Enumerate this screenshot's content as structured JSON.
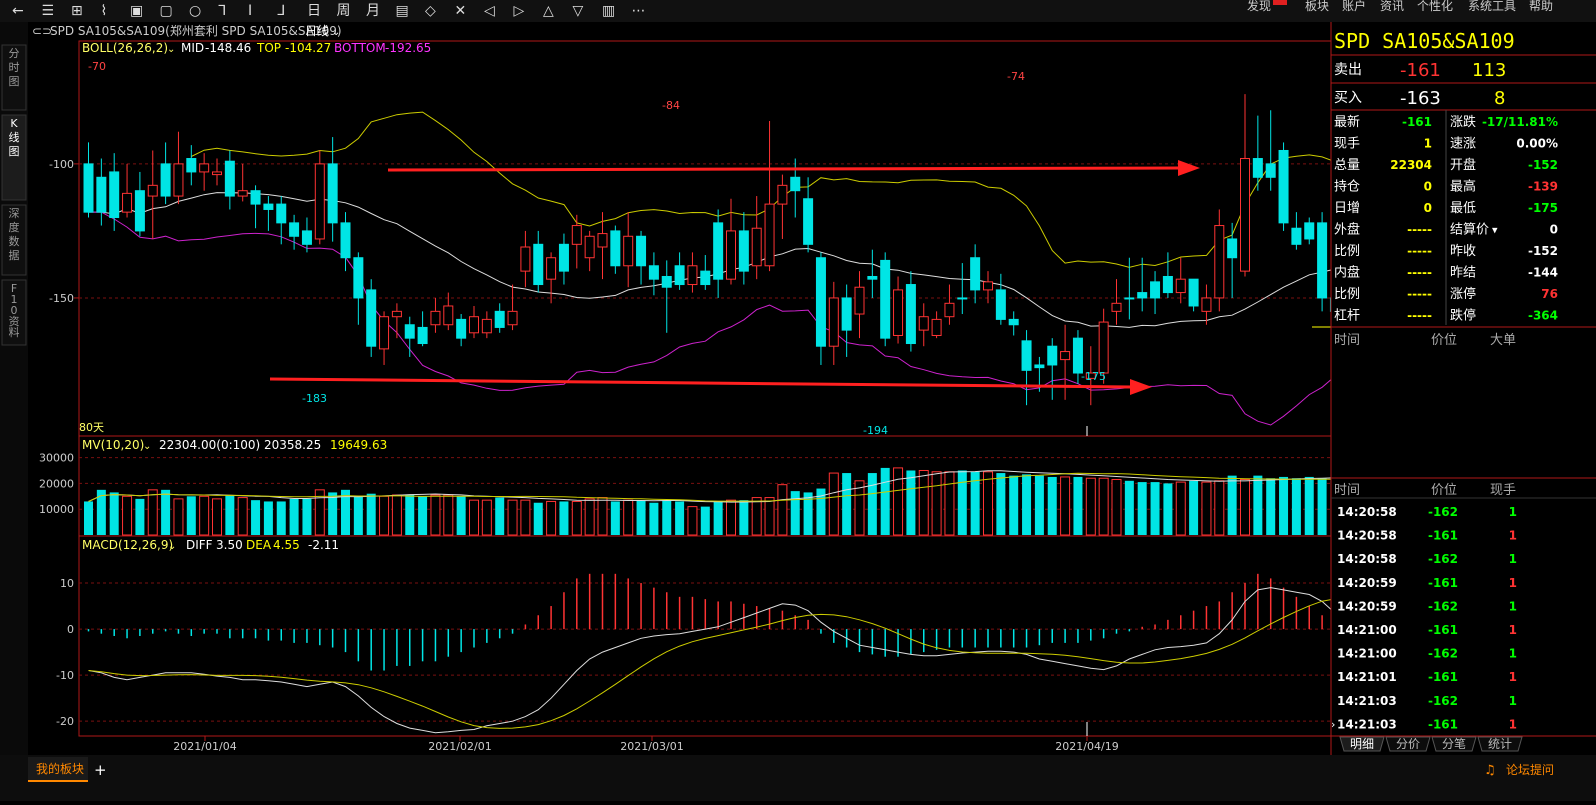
{
  "toolbar": {
    "left_icons": [
      "back-icon",
      "list-icon",
      "layout-icon",
      "line-tool-icon",
      "page-icon",
      "folder-icon",
      "circle-icon",
      "step-icon",
      "step2-icon",
      "step3-icon",
      "day-icon",
      "week-icon",
      "month-icon",
      "note-icon",
      "expand-icon",
      "collapse-icon",
      "prev-icon",
      "next-icon",
      "up-icon",
      "down-icon",
      "grid-icon",
      "more-icon"
    ],
    "glyphs": [
      "←",
      "☰",
      "⊞",
      "⌇",
      "▣",
      "▢",
      "○",
      "⅂",
      "Ⅰ",
      "⅃",
      "日",
      "周",
      "月",
      "▤",
      "◇",
      "✕",
      "◁",
      "▷",
      "△",
      "▽",
      "▥",
      "⋯"
    ],
    "menu": [
      "发现",
      "板块",
      "账户",
      "资讯",
      "个性化",
      "系统工具",
      "帮助"
    ]
  },
  "side_tabs": [
    "分时图",
    "K线图",
    "深度数据",
    "F10资料"
  ],
  "chart_header": {
    "title": "SPD SA105&SA109(郑州套利 SPD SA105&SA109)",
    "period": "日线"
  },
  "boll": {
    "name": "BOLL(26,26,2)",
    "mid_label": "MID",
    "mid": "-148.46",
    "top_label": "TOP",
    "top": "-104.27",
    "bottom_label": "BOTTOM",
    "bottom": "-192.65"
  },
  "volume_header": {
    "name": "MV(10,20)",
    "v1": "22304.00(0:100)",
    "v2": "20358.25",
    "v3": "19649.63"
  },
  "macd_header": {
    "name": "MACD(12,26,9)",
    "diff_label": "DIFF",
    "diff": "3.50",
    "dea_label": "DEA",
    "dea": "4.55",
    "macd": "-2.11"
  },
  "days_label": "80天",
  "price_axis": [
    "-100",
    "-150"
  ],
  "volume_axis": [
    "30000",
    "20000",
    "10000"
  ],
  "macd_axis": [
    "10",
    "0",
    "-10",
    "-20"
  ],
  "date_axis": [
    "2021/01/04",
    "2021/02/01",
    "2021/03/01",
    "2021/04/19"
  ],
  "annotations": {
    "high1": "-70",
    "high2": "-84",
    "high3": "-74",
    "low1": "-183",
    "low2": "-194",
    "low3": "-175"
  },
  "chart_data": {
    "type": "candlestick",
    "price_ylim": [
      -200,
      -62
    ],
    "volume_ylim": [
      0,
      31000
    ],
    "macd_ylim": [
      -23,
      15
    ],
    "candles": [
      [
        -100,
        -118,
        -92,
        -120
      ],
      [
        -105,
        -118,
        -98,
        -123
      ],
      [
        -103,
        -120,
        -96,
        -125
      ],
      [
        -118,
        -111,
        -100,
        -120
      ],
      [
        -110,
        -125,
        -103,
        -127
      ],
      [
        -112,
        -108,
        -95,
        -128
      ],
      [
        -100,
        -112,
        -92,
        -115
      ],
      [
        -112,
        -100,
        -88,
        -115
      ],
      [
        -98,
        -103,
        -93,
        -108
      ],
      [
        -103,
        -100,
        -96,
        -110
      ],
      [
        -104,
        -103,
        -98,
        -108
      ],
      [
        -99,
        -112,
        -95,
        -117
      ],
      [
        -112,
        -110,
        -100,
        -114
      ],
      [
        -110,
        -115,
        -108,
        -124
      ],
      [
        -115,
        -117,
        -112,
        -125
      ],
      [
        -115,
        -122,
        -112,
        -130
      ],
      [
        -122,
        -127,
        -119,
        -132
      ],
      [
        -125,
        -130,
        -120,
        -133
      ],
      [
        -128,
        -100,
        -95,
        -130
      ],
      [
        -100,
        -122,
        -90,
        -129
      ],
      [
        -122,
        -135,
        -118,
        -140
      ],
      [
        -135,
        -150,
        -133,
        -160
      ],
      [
        -147,
        -168,
        -143,
        -172
      ],
      [
        -169,
        -157,
        -155,
        -175
      ],
      [
        -157,
        -155,
        -152,
        -165
      ],
      [
        -160,
        -165,
        -157,
        -172
      ],
      [
        -161,
        -167,
        -155,
        -168
      ],
      [
        -160,
        -155,
        -150,
        -163
      ],
      [
        -160,
        -153,
        -148,
        -162
      ],
      [
        -158,
        -165,
        -156,
        -168
      ],
      [
        -163,
        -157,
        -153,
        -165
      ],
      [
        -163,
        -158,
        -155,
        -165
      ],
      [
        -155,
        -161,
        -152,
        -163
      ],
      [
        -160,
        -155,
        -145,
        -162
      ],
      [
        -140,
        -131,
        -125,
        -146
      ],
      [
        -130,
        -145,
        -125,
        -148
      ],
      [
        -143,
        -135,
        -133,
        -152
      ],
      [
        -130,
        -140,
        -126,
        -145
      ],
      [
        -130,
        -123,
        -119,
        -139
      ],
      [
        -135,
        -127,
        -125,
        -140
      ],
      [
        -131,
        -126,
        -118,
        -143
      ],
      [
        -125,
        -138,
        -123,
        -141
      ],
      [
        -138,
        -127,
        -118,
        -146
      ],
      [
        -127,
        -138,
        -125,
        -145
      ],
      [
        -138,
        -143,
        -133,
        -149
      ],
      [
        -142,
        -146,
        -136,
        -163
      ],
      [
        -138,
        -145,
        -133,
        -147
      ],
      [
        -145,
        -138,
        -133,
        -148
      ],
      [
        -140,
        -145,
        -134,
        -147
      ],
      [
        -122,
        -143,
        -117,
        -150
      ],
      [
        -143,
        -125,
        -113,
        -145
      ],
      [
        -125,
        -140,
        -118,
        -145
      ],
      [
        -138,
        -124,
        -112,
        -143
      ],
      [
        -138,
        -115,
        -84,
        -140
      ],
      [
        -115,
        -108,
        -104,
        -128
      ],
      [
        -105,
        -110,
        -98,
        -120
      ],
      [
        -113,
        -130,
        -105,
        -133
      ],
      [
        -135,
        -168,
        -133,
        -175
      ],
      [
        -168,
        -150,
        -144,
        -175
      ],
      [
        -150,
        -162,
        -145,
        -172
      ],
      [
        -156,
        -146,
        -140,
        -165
      ],
      [
        -142,
        -143,
        -132,
        -150
      ],
      [
        -136,
        -165,
        -133,
        -168
      ],
      [
        -164,
        -147,
        -142,
        -167
      ],
      [
        -145,
        -167,
        -140,
        -170
      ],
      [
        -162,
        -157,
        -152,
        -168
      ],
      [
        -164,
        -158,
        -155,
        -165
      ],
      [
        -157,
        -152,
        -145,
        -160
      ],
      [
        -150,
        -150,
        -137,
        -156
      ],
      [
        -135,
        -147,
        -130,
        -152
      ],
      [
        -147,
        -144,
        -140,
        -152
      ],
      [
        -147,
        -158,
        -141,
        -160
      ],
      [
        -158,
        -160,
        -155,
        -164
      ],
      [
        -166,
        -177,
        -162,
        -190
      ],
      [
        -175,
        -176,
        -172,
        -185
      ],
      [
        -168,
        -175,
        -165,
        -188
      ],
      [
        -173,
        -170,
        -160,
        -188
      ],
      [
        -165,
        -178,
        -162,
        -182
      ],
      [
        -180,
        -178,
        -168,
        -190
      ],
      [
        -178,
        -159,
        -154,
        -182
      ],
      [
        -155,
        -152,
        -143,
        -160
      ],
      [
        -150,
        -150,
        -135,
        -158
      ],
      [
        -148,
        -150,
        -135,
        -155
      ],
      [
        -144,
        -150,
        -140,
        -156
      ],
      [
        -142,
        -148,
        -133,
        -150
      ],
      [
        -148,
        -143,
        -135,
        -152
      ],
      [
        -143,
        -153,
        -143,
        -155
      ],
      [
        -155,
        -150,
        -145,
        -160
      ],
      [
        -150,
        -123,
        -117,
        -155
      ],
      [
        -128,
        -135,
        -122,
        -150
      ],
      [
        -140,
        -98,
        -74,
        -142
      ],
      [
        -98,
        -105,
        -82,
        -110
      ],
      [
        -100,
        -105,
        -80,
        -110
      ],
      [
        -95,
        -122,
        -92,
        -125
      ],
      [
        -124,
        -130,
        -118,
        -132
      ],
      [
        -122,
        -128,
        -120,
        -130
      ],
      [
        -122,
        -150,
        -118,
        -155
      ],
      [
        -150,
        -155,
        -140,
        -162
      ],
      [
        -152,
        -161,
        -148,
        -175
      ]
    ],
    "volume": [
      13000,
      17500,
      16500,
      15000,
      14000,
      17500,
      17500,
      14000,
      15000,
      15000,
      14000,
      15500,
      14500,
      13500,
      13000,
      13000,
      14000,
      14000,
      17500,
      16500,
      17500,
      15000,
      16000,
      15000,
      15500,
      15500,
      15000,
      15500,
      15500,
      15000,
      13500,
      13500,
      14500,
      13500,
      13500,
      12500,
      13000,
      13000,
      13000,
      14000,
      14500,
      13000,
      13500,
      13500,
      12500,
      13500,
      13000,
      11000,
      11000,
      13000,
      13500,
      13500,
      14500,
      14500,
      19500,
      17000,
      16500,
      18000,
      24000,
      24000,
      21000,
      24000,
      26000,
      26000,
      25000,
      25000,
      24500,
      24500,
      25000,
      24500,
      24500,
      24000,
      23000,
      23500,
      23000,
      22500,
      22500,
      22500,
      22000,
      22000,
      21500,
      21000,
      20500,
      20500,
      20000,
      20500,
      21000,
      20500,
      21000,
      23000,
      21500,
      23000,
      22000,
      22500,
      22000,
      22500,
      22000,
      22304
    ],
    "macd_hist": [
      -0.5,
      -1,
      -1.5,
      -2,
      -1.5,
      -1,
      -0.5,
      -1,
      -1.5,
      -1,
      -1,
      -2,
      -2,
      -2,
      -2.5,
      -2.5,
      -3,
      -3,
      -3.5,
      -4,
      -5,
      -7,
      -9,
      -9,
      -8,
      -8,
      -7,
      -7,
      -6,
      -5,
      -4,
      -3,
      -2,
      -1,
      1,
      3,
      5,
      8,
      11,
      12,
      12,
      12,
      11,
      10,
      9,
      8,
      7,
      7,
      6.5,
      6,
      6,
      5.5,
      5,
      4.5,
      4,
      3,
      2,
      -1,
      -3,
      -4,
      -5,
      -5.5,
      -6,
      -6,
      -5.5,
      -5,
      -4.5,
      -4,
      -4,
      -4,
      -4,
      -4,
      -4,
      -4,
      -3.5,
      -3,
      -3,
      -3,
      -2.5,
      -2,
      -1,
      -0.5,
      0.5,
      1,
      2,
      3,
      4,
      5,
      6,
      8,
      10,
      12,
      11,
      9,
      7,
      5,
      3,
      -2
    ],
    "macd_diff": [
      -9,
      -9.5,
      -10.5,
      -11,
      -10.5,
      -10,
      -9.5,
      -9.5,
      -9.5,
      -9.8,
      -10.2,
      -10.5,
      -11,
      -11,
      -11.2,
      -11.5,
      -12,
      -12.5,
      -12,
      -11.5,
      -12.5,
      -14.5,
      -17,
      -19,
      -20.5,
      -21.5,
      -22,
      -22.5,
      -22.3,
      -22,
      -21.8,
      -21,
      -20.5,
      -20,
      -19,
      -17.5,
      -15,
      -12,
      -9,
      -6.5,
      -5,
      -4,
      -3,
      -2,
      -1.5,
      -1.2,
      -1,
      -0.5,
      0,
      0.5,
      1.5,
      2.5,
      3.5,
      4.5,
      5.5,
      5.2,
      4,
      1.5,
      -0.5,
      -2,
      -3.5,
      -4,
      -4.5,
      -5,
      -5.5,
      -5.8,
      -5.8,
      -5.5,
      -5.2,
      -5,
      -4.8,
      -4.8,
      -5,
      -5.5,
      -6.5,
      -7,
      -7.5,
      -8,
      -8.5,
      -8.8,
      -8,
      -6.5,
      -5.5,
      -4.5,
      -4,
      -3.8,
      -3.5,
      -3,
      -1,
      2,
      6,
      8.5,
      9,
      8.5,
      8,
      7.5,
      6,
      3.5
    ]
  },
  "quote": {
    "title": "SPD  SA105&SA109",
    "sell_label": "卖出",
    "sell_price": "-161",
    "sell_qty": "113",
    "buy_label": "买入",
    "buy_price": "-163",
    "buy_qty": "8",
    "rows": [
      {
        "l1": "最新",
        "v1": "-161",
        "c1": "#00ff00",
        "l2": "涨跌",
        "v2": "-17/11.81%",
        "c2": "#00ff00"
      },
      {
        "l1": "现手",
        "v1": "1",
        "c1": "#ffff00",
        "l2": "速涨",
        "v2": "0.00%",
        "c2": "#ffffff"
      },
      {
        "l1": "总量",
        "v1": "22304",
        "c1": "#ffff00",
        "l2": "开盘",
        "v2": "-152",
        "c2": "#00ff00"
      },
      {
        "l1": "持仓",
        "v1": "0",
        "c1": "#ffff00",
        "l2": "最高",
        "v2": "-139",
        "c2": "#ff3333"
      },
      {
        "l1": "日增",
        "v1": "0",
        "c1": "#ffff00",
        "l2": "最低",
        "v2": "-175",
        "c2": "#00ff00"
      },
      {
        "l1": "外盘",
        "v1": "-----",
        "c1": "#ffff00",
        "l2": "结算价",
        "v2": "0",
        "c2": "#ffffff"
      },
      {
        "l1": "比例",
        "v1": "-----",
        "c1": "#ffff00",
        "l2": "昨收",
        "v2": "-152",
        "c2": "#ffffff"
      },
      {
        "l1": "内盘",
        "v1": "-----",
        "c1": "#ffff00",
        "l2": "昨结",
        "v2": "-144",
        "c2": "#ffffff"
      },
      {
        "l1": "比例",
        "v1": "-----",
        "c1": "#ffff00",
        "l2": "涨停",
        "v2": "76",
        "c2": "#ff3333"
      },
      {
        "l1": "杠杆",
        "v1": "-----",
        "c1": "#ffff00",
        "l2": "跌停",
        "v2": "-364",
        "c2": "#00ff00"
      }
    ],
    "big_header": [
      "时间",
      "价位",
      "大单"
    ],
    "trades_header": [
      "时间",
      "价位",
      "现手"
    ],
    "trades": [
      {
        "t": "14:20:58",
        "p": "-162",
        "pc": "#00ff00",
        "q": "1",
        "qc": "#00ff00"
      },
      {
        "t": "14:20:58",
        "p": "-161",
        "pc": "#00ff00",
        "q": "1",
        "qc": "#ff3333"
      },
      {
        "t": "14:20:58",
        "p": "-162",
        "pc": "#00ff00",
        "q": "1",
        "qc": "#00ff00"
      },
      {
        "t": "14:20:59",
        "p": "-161",
        "pc": "#00ff00",
        "q": "1",
        "qc": "#ff3333"
      },
      {
        "t": "14:20:59",
        "p": "-162",
        "pc": "#00ff00",
        "q": "1",
        "qc": "#00ff00"
      },
      {
        "t": "14:21:00",
        "p": "-161",
        "pc": "#00ff00",
        "q": "1",
        "qc": "#ff3333"
      },
      {
        "t": "14:21:00",
        "p": "-162",
        "pc": "#00ff00",
        "q": "1",
        "qc": "#00ff00"
      },
      {
        "t": "14:21:01",
        "p": "-161",
        "pc": "#00ff00",
        "q": "1",
        "qc": "#ff3333"
      },
      {
        "t": "14:21:03",
        "p": "-162",
        "pc": "#00ff00",
        "q": "1",
        "qc": "#00ff00"
      },
      {
        "t": "14:21:03",
        "p": "-161",
        "pc": "#00ff00",
        "q": "1",
        "qc": "#ff3333"
      }
    ],
    "tabs": [
      "明细",
      "分价",
      "分笔",
      "统计"
    ]
  },
  "bottom": {
    "tab": "我的板块",
    "add": "+",
    "forum": "论坛提问"
  }
}
